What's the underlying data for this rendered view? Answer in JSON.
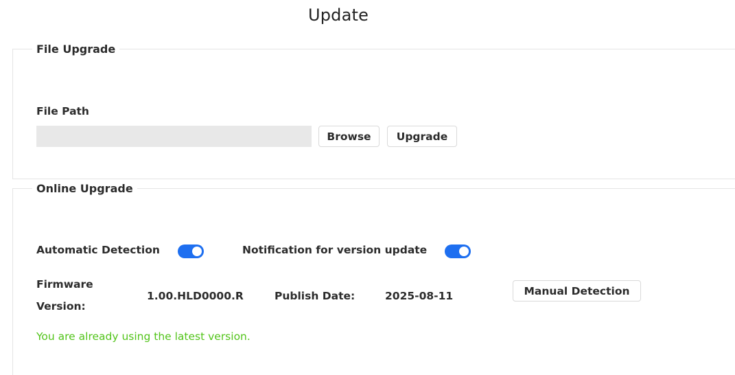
{
  "page": {
    "title": "Update"
  },
  "file_upgrade": {
    "legend": "File Upgrade",
    "file_path_label": "File Path",
    "file_path_value": "",
    "browse_label": "Browse",
    "upgrade_label": "Upgrade"
  },
  "online_upgrade": {
    "legend": "Online Upgrade",
    "auto_detection_label": "Automatic Detection",
    "auto_detection_enabled": true,
    "notification_label": "Notification for version update",
    "notification_enabled": true,
    "firmware_label_line1": "Firmware",
    "firmware_label_line2": "Version:",
    "firmware_version": "1.00.HLD0000.R",
    "publish_date_label": "Publish Date:",
    "publish_date": "2025-08-11",
    "manual_detection_label": "Manual Detection",
    "status_message": "You are already using the latest version."
  },
  "colors": {
    "toggle_on": "#1e6ff0",
    "status_ok": "#52c41a"
  }
}
